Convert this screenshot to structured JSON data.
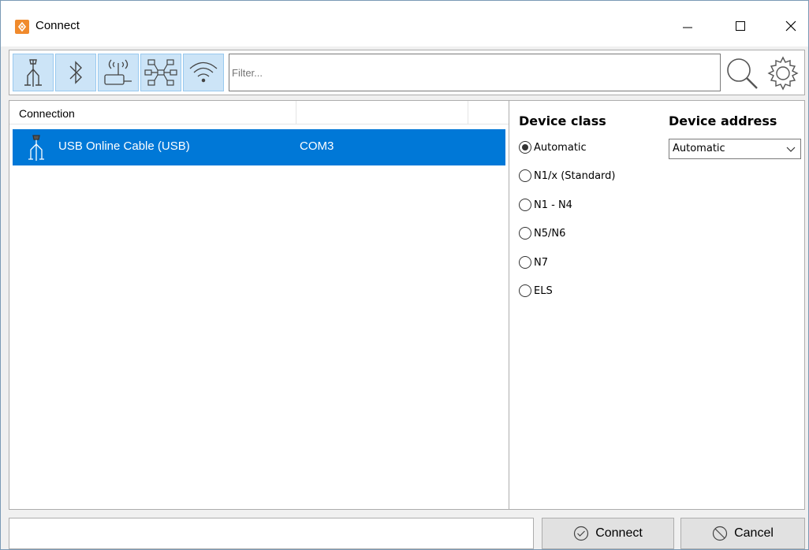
{
  "window": {
    "title": "Connect"
  },
  "toolbar": {
    "tools": [
      {
        "icon": "usb-cable-icon"
      },
      {
        "icon": "bluetooth-icon"
      },
      {
        "icon": "wireless-router-icon"
      },
      {
        "icon": "network-icon"
      },
      {
        "icon": "wifi-icon"
      }
    ],
    "filter_placeholder": "Filter..."
  },
  "list": {
    "columns": [
      "Connection",
      "",
      ""
    ],
    "rows": [
      {
        "name": "USB Online Cable (USB)",
        "port": "COM3",
        "selected": true
      }
    ]
  },
  "device_class": {
    "heading": "Device class",
    "options": [
      {
        "label": "Automatic",
        "checked": true
      },
      {
        "label": "N1/x (Standard)",
        "checked": false
      },
      {
        "label": "N1 - N4",
        "checked": false
      },
      {
        "label": "N5/N6",
        "checked": false
      },
      {
        "label": "N7",
        "checked": false
      },
      {
        "label": "ELS",
        "checked": false
      }
    ]
  },
  "device_address": {
    "heading": "Device address",
    "selected": "Automatic"
  },
  "buttons": {
    "connect": "Connect",
    "cancel": "Cancel"
  },
  "colors": {
    "selection": "#0078d7",
    "tool_bg": "#cce4f7",
    "app_icon": "#f08a2c"
  }
}
